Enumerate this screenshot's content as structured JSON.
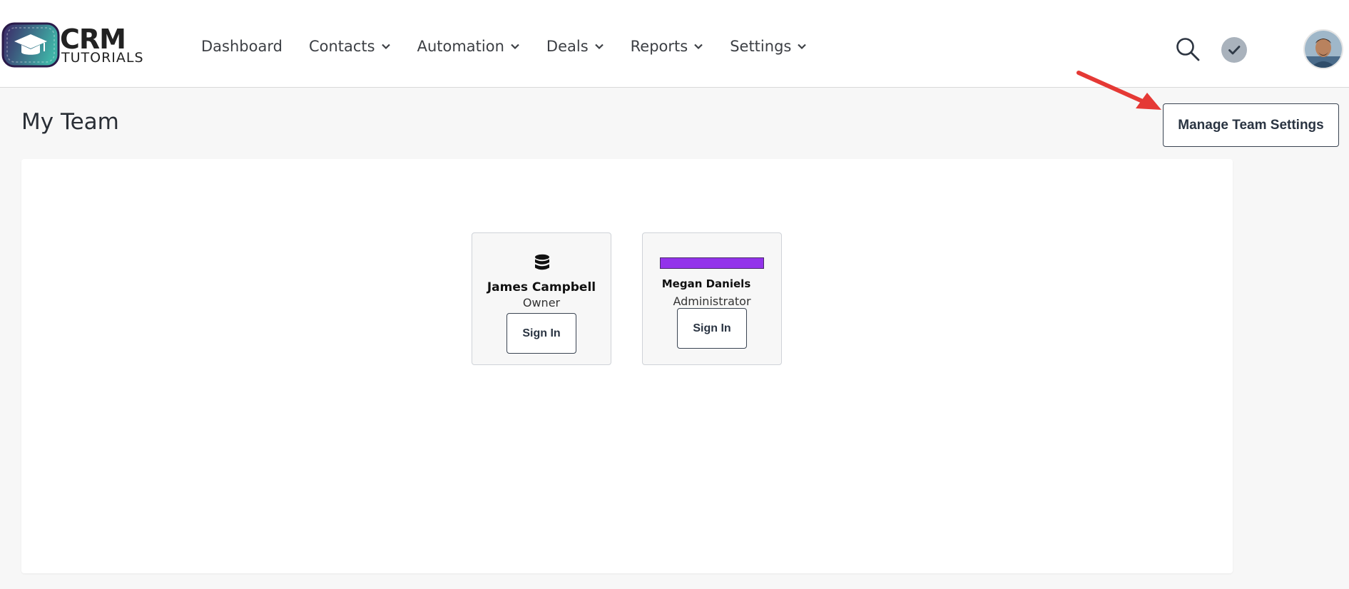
{
  "brand": {
    "line1": "CRM",
    "line2": "TUTORIALS",
    "icon": "graduation-cap-icon",
    "colors": {
      "frame_dark": "#3b2566",
      "frame_light": "#3fb1a6",
      "cap": "#ffffff"
    }
  },
  "nav": [
    {
      "label": "Dashboard",
      "has_dropdown": false
    },
    {
      "label": "Contacts",
      "has_dropdown": true
    },
    {
      "label": "Automation",
      "has_dropdown": true
    },
    {
      "label": "Deals",
      "has_dropdown": true
    },
    {
      "label": "Reports",
      "has_dropdown": true
    },
    {
      "label": "Settings",
      "has_dropdown": true
    }
  ],
  "header_icons": {
    "search": "search-icon",
    "status": "check-circle-icon",
    "avatar": "user-avatar"
  },
  "page": {
    "title": "My Team",
    "manage_button": "Manage Team Settings"
  },
  "annotation": {
    "arrow_color": "#e53935",
    "points_to": "Manage Team Settings"
  },
  "team": [
    {
      "name": "James Campbell",
      "role": "Owner",
      "button": "Sign In",
      "icon": "database-icon"
    },
    {
      "name": "Megan Daniels",
      "role": "Administrator",
      "button": "Sign In",
      "badge_color": "#9333ea"
    }
  ],
  "colors": {
    "accent_purple": "#9333ea",
    "text_dark": "#2a3442",
    "background": "#f7f7f7"
  }
}
